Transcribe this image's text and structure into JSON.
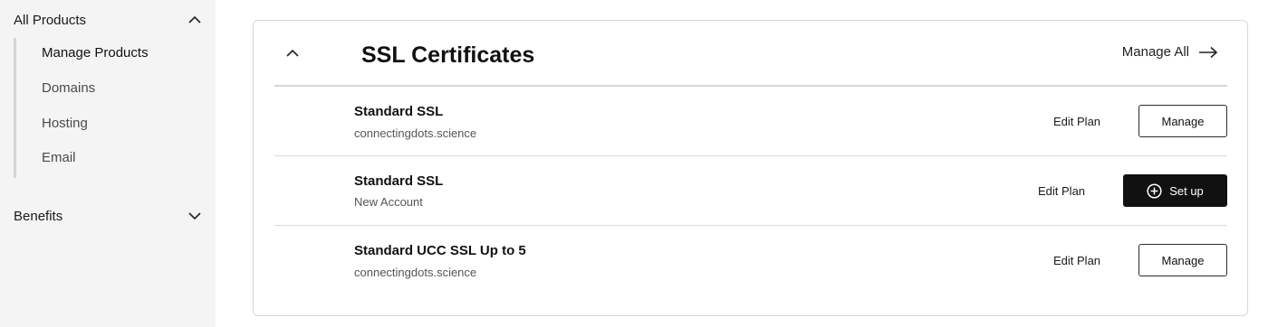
{
  "sidebar": {
    "all_products": {
      "label": "All Products",
      "icon": "chevron-up-icon",
      "items": [
        {
          "label": "Manage Products"
        },
        {
          "label": "Domains"
        },
        {
          "label": "Hosting"
        },
        {
          "label": "Email"
        }
      ]
    },
    "benefits": {
      "label": "Benefits",
      "icon": "chevron-down-icon"
    }
  },
  "card": {
    "title": "SSL Certificates",
    "collapse_icon": "chevron-up-icon",
    "manage_all_label": "Manage All",
    "manage_all_icon": "arrow-right-icon",
    "rows": [
      {
        "name": "Standard SSL",
        "subtitle": "connectingdots.science",
        "edit_label": "Edit Plan",
        "action_label": "Manage"
      },
      {
        "name": "Standard SSL",
        "subtitle": "New Account",
        "edit_label": "Edit Plan",
        "action_label": "Set up",
        "action_icon": "plus-circle-icon"
      },
      {
        "name": "Standard UCC SSL Up to 5",
        "subtitle": "connectingdots.science",
        "edit_label": "Edit Plan",
        "action_label": "Manage"
      }
    ]
  },
  "colors": {
    "sidebar_bg": "#f4f4f4",
    "primary_button": "#111111",
    "divider": "#d6dcdf"
  }
}
